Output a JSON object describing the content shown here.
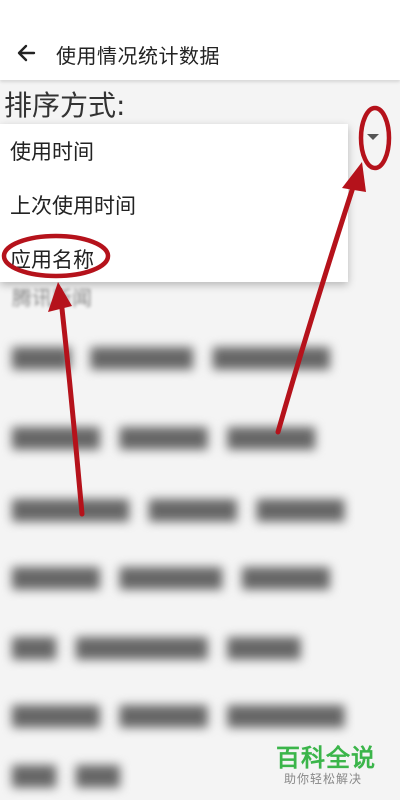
{
  "appbar": {
    "title": "使用情况统计数据",
    "back_icon": "arrow-left-icon"
  },
  "sort": {
    "label": "排序方式:",
    "options": [
      "使用时间",
      "上次使用时间",
      "应用名称"
    ],
    "selected": "使用时间"
  },
  "list": {
    "partial_item": "腾讯新闻"
  },
  "annotation": {
    "color": "#b5121b"
  },
  "watermark": {
    "title": "百科全说",
    "subtitle": "助你轻松解决",
    "color": "#3bb54a"
  }
}
